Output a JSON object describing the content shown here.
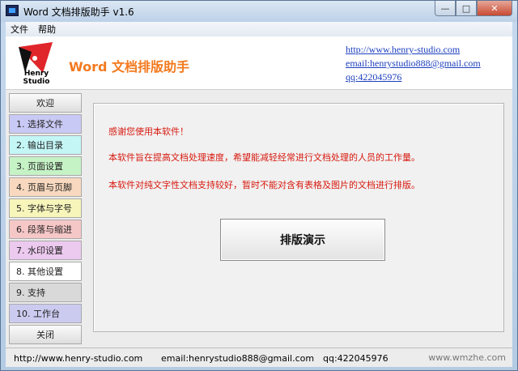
{
  "window": {
    "title": "Word 文档排版助手 v1.6"
  },
  "menu": {
    "items": [
      "文件",
      "帮助"
    ]
  },
  "header": {
    "logo_text": "Henry Studio",
    "app_title": "Word 文档排版助手",
    "links": [
      "http://www.henry-studio.com",
      "email:henrystudio888@gmail.com",
      "qq:422045976"
    ]
  },
  "sidebar": {
    "items": [
      {
        "label": "欢迎",
        "color": "#e6e6e6"
      },
      {
        "label": "1. 选择文件",
        "color": "#c9c9f5"
      },
      {
        "label": "2. 输出目录",
        "color": "#c4f6f6"
      },
      {
        "label": "3. 页面设置",
        "color": "#c6f3c6"
      },
      {
        "label": "4. 页眉与页脚",
        "color": "#f8d9bf"
      },
      {
        "label": "5. 字体与字号",
        "color": "#f7f5ba"
      },
      {
        "label": "6. 段落与缩进",
        "color": "#f6c7c7"
      },
      {
        "label": "7. 水印设置",
        "color": "#ecc9ef"
      },
      {
        "label": "8. 其他设置",
        "color": "#ffffff"
      },
      {
        "label": "9. 支持",
        "color": "#d9d9d9"
      },
      {
        "label": "10. 工作台",
        "color": "#cbcbf0"
      },
      {
        "label": "关闭",
        "color": "#e6e6e6"
      }
    ]
  },
  "content": {
    "messages": [
      "感谢您使用本软件！",
      "本软件旨在提高文档处理速度，希望能减轻经常进行文档处理的人员的工作量。",
      "本软件对纯文字性文档支持较好，暂时不能对含有表格及图片的文档进行排版。"
    ],
    "demo_button": "排版演示"
  },
  "footer": {
    "website": "http://www.henry-studio.com",
    "email": "email:henrystudio888@gmail.com",
    "qq": "qq:422045976",
    "watermark": "www.wmzhe.com"
  },
  "colors": {
    "accent_title": "#f37a1f",
    "message_red": "#d8190f",
    "link_blue": "#1c3fbd"
  }
}
